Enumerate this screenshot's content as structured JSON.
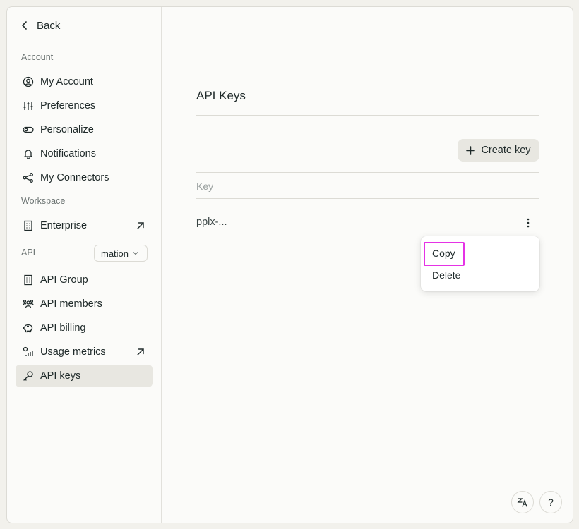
{
  "sidebar": {
    "back_label": "Back",
    "account_section": "Account",
    "account_items": [
      {
        "label": "My Account",
        "icon": "user-circle-icon"
      },
      {
        "label": "Preferences",
        "icon": "sliders-icon"
      },
      {
        "label": "Personalize",
        "icon": "toggle-icon"
      },
      {
        "label": "Notifications",
        "icon": "bell-icon"
      },
      {
        "label": "My Connectors",
        "icon": "connectors-icon"
      }
    ],
    "workspace_section": "Workspace",
    "workspace_items": [
      {
        "label": "Enterprise",
        "icon": "building-icon",
        "external": true
      }
    ],
    "api_section": "API",
    "api_group_select": "mation",
    "api_items": [
      {
        "label": "API Group",
        "icon": "building-icon"
      },
      {
        "label": "API members",
        "icon": "users-icon"
      },
      {
        "label": "API billing",
        "icon": "piggy-bank-icon"
      },
      {
        "label": "Usage metrics",
        "icon": "metrics-icon",
        "external": true
      },
      {
        "label": "API keys",
        "icon": "key-icon",
        "active": true
      }
    ]
  },
  "main": {
    "title": "API Keys",
    "create_key_label": "Create key",
    "table": {
      "header": "Key",
      "rows": [
        {
          "key": "pplx-..."
        }
      ]
    },
    "context_menu": {
      "items": [
        "Copy",
        "Delete"
      ],
      "highlighted": "Copy"
    }
  },
  "footer": {
    "translate_icon": "translate-icon",
    "help_label": "?"
  }
}
